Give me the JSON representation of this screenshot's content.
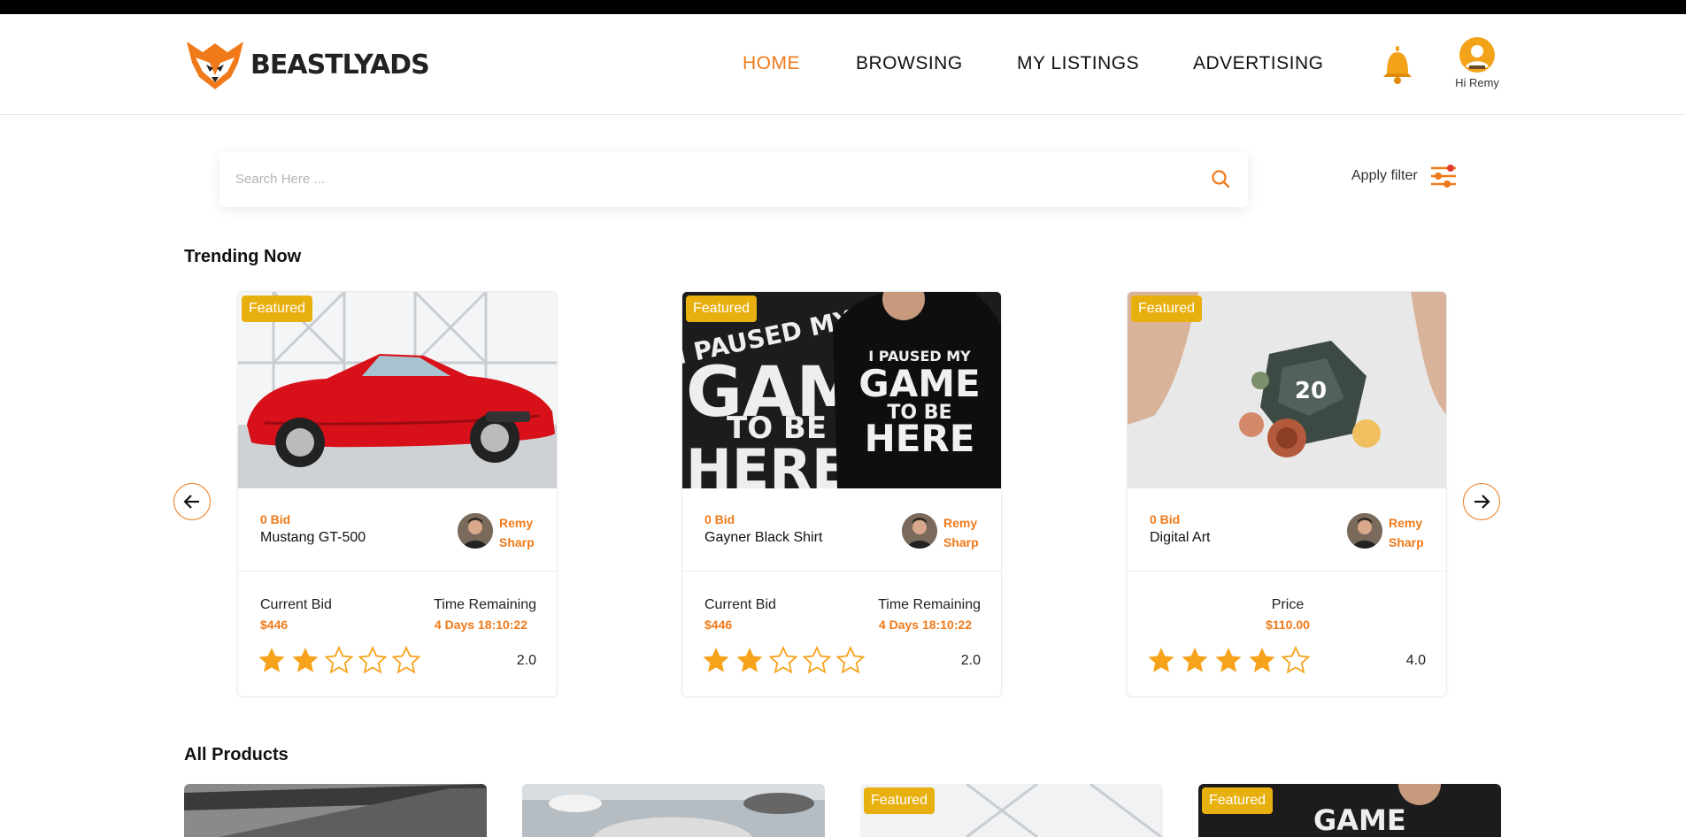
{
  "brand": {
    "name": "BEASTLYADS",
    "accent": "#f07a1a"
  },
  "nav": {
    "items": [
      {
        "label": "HOME",
        "active": true
      },
      {
        "label": "BROWSING",
        "active": false
      },
      {
        "label": "MY LISTINGS",
        "active": false
      },
      {
        "label": "ADVERTISING",
        "active": false
      }
    ],
    "notifications_icon": "bell-icon",
    "user_greeting": "Hi Remy"
  },
  "search": {
    "placeholder": "Search Here ...",
    "value": ""
  },
  "filter": {
    "label": "Apply filter"
  },
  "trending": {
    "title": "Trending Now",
    "cards": [
      {
        "badge": "Featured",
        "bids": "0 Bid",
        "name": "Mustang GT-500",
        "seller_first": "Remy",
        "seller_last": "Sharp",
        "left_label": "Current Bid",
        "left_value": "$446",
        "right_label": "Time Remaining",
        "right_value": "4 Days 18:10:22",
        "stars": 2,
        "rating": "2.0"
      },
      {
        "badge": "Featured",
        "bids": "0 Bid",
        "name": "Gayner Black Shirt",
        "seller_first": "Remy",
        "seller_last": "Sharp",
        "left_label": "Current Bid",
        "left_value": "$446",
        "right_label": "Time Remaining",
        "right_value": "4 Days 18:10:22",
        "stars": 2,
        "rating": "2.0"
      },
      {
        "badge": "Featured",
        "bids": "0 Bid",
        "name": "Digital Art",
        "seller_first": "Remy",
        "seller_last": "Sharp",
        "price_label": "Price",
        "price_value": "$110.00",
        "stars": 4,
        "rating": "4.0"
      }
    ]
  },
  "all_products": {
    "title": "All Products",
    "badges": [
      "Featured",
      "Featured"
    ]
  },
  "images": {
    "shirt_text_1": "I PAUSED MY",
    "shirt_text_2": "GAME",
    "shirt_text_3": "TO BE",
    "shirt_text_4": "HERE",
    "dice_number": "20"
  }
}
